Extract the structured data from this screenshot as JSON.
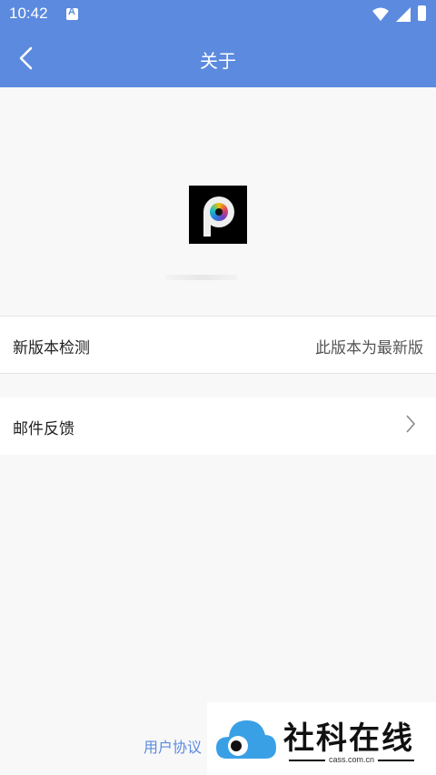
{
  "status_bar": {
    "time": "10:42"
  },
  "nav": {
    "title": "关于"
  },
  "update_row": {
    "label": "新版本检测",
    "value": "此版本为最新版"
  },
  "mail_row": {
    "label": "邮件反馈"
  },
  "footer": {
    "agreement": "用户协议"
  },
  "watermark": {
    "name": "社科在线",
    "domain": "cass.com.cn"
  },
  "colors": {
    "primary": "#5b8adf",
    "background": "#f8f8f8"
  }
}
